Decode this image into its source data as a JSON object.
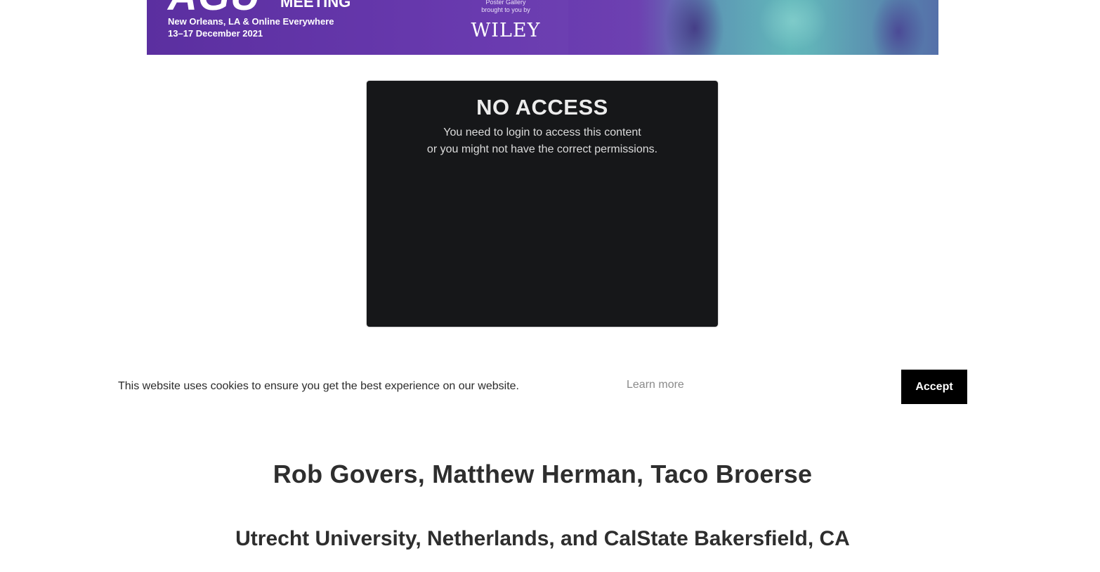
{
  "banner": {
    "org": "AGU",
    "meeting": "MEETING",
    "location": "New Orleans, LA & Online Everywhere",
    "dates": "13–17 December 2021",
    "poster_line1": "Poster Gallery",
    "poster_line2": "brought to you by",
    "sponsor": "WILEY"
  },
  "no_access": {
    "title": "NO ACCESS",
    "line1": "You need to login to access this content",
    "line2": "or you might not have the correct permissions."
  },
  "cookie_bar": {
    "message": "This website uses cookies to ensure you get the best experience on our website.",
    "learn_more": "Learn more",
    "accept": "Accept"
  },
  "poster": {
    "authors": "Rob Govers, Matthew Herman, Taco Broerse",
    "affiliation": "Utrecht University, Netherlands, and CalState Bakersfield, CA"
  }
}
